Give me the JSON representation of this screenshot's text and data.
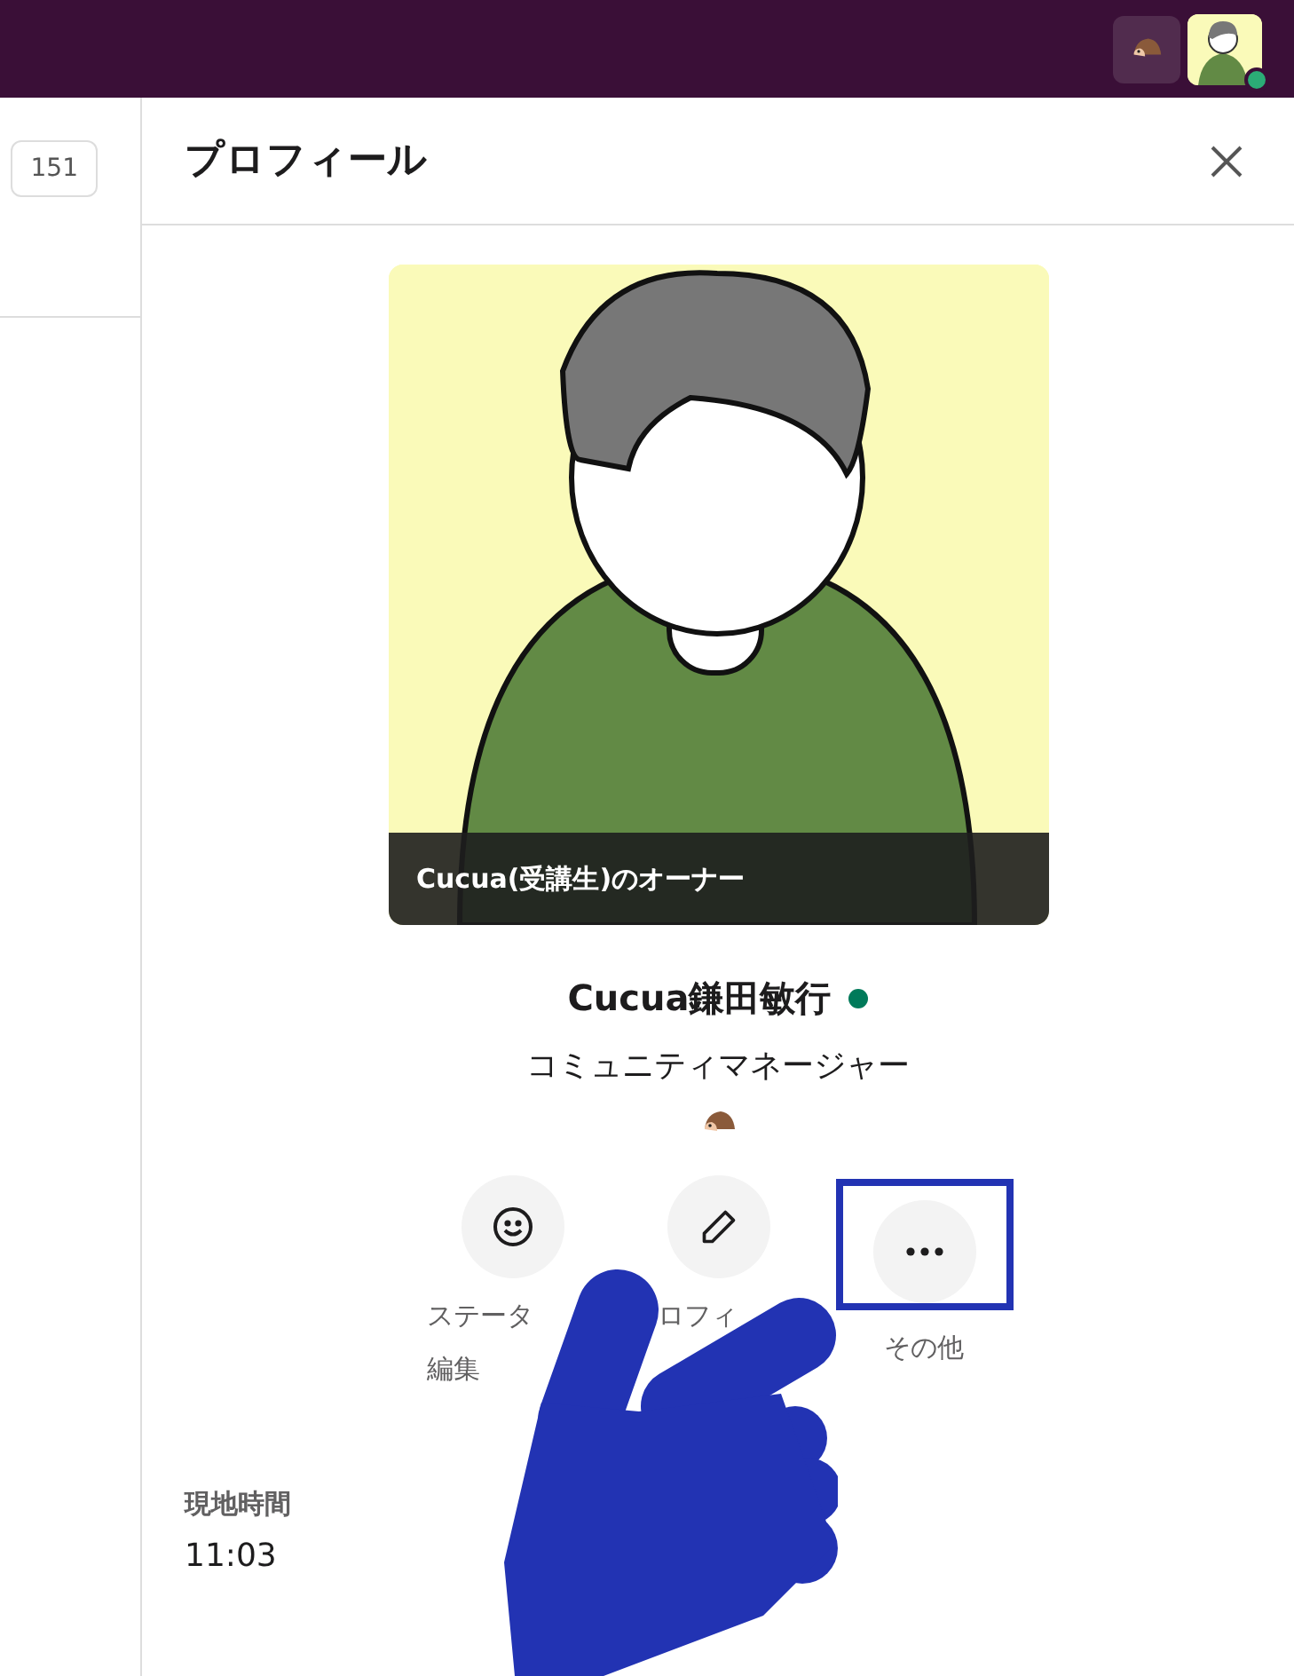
{
  "top_bar": {
    "online": true
  },
  "left_pane": {
    "badge": "151"
  },
  "profile_panel": {
    "title": "プロフィール",
    "photo_caption": "Cucua(受講生)のオーナー",
    "name": "Cucua鎌田敏行",
    "online": true,
    "job_title": "コミュニティマネージャー",
    "actions": [
      {
        "kind": "status",
        "label_lines": [
          "ステータ",
          "編集"
        ],
        "highlighted": false
      },
      {
        "kind": "edit",
        "label_lines": [
          "ロフィ"
        ],
        "highlighted": false
      },
      {
        "kind": "more",
        "label_lines": [
          "その他"
        ],
        "highlighted": true
      }
    ],
    "local_time": {
      "label": "現地時間",
      "value": "11:03"
    }
  }
}
